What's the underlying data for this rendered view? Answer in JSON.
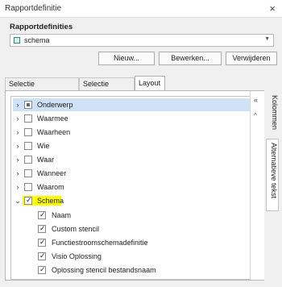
{
  "window": {
    "title": "Rapportdefinitie",
    "close_icon": "×"
  },
  "group": {
    "label": "Rapportdefinities",
    "combo_value": "schema",
    "buttons": {
      "new": "Nieuw...",
      "edit": "Bewerken...",
      "delete": "Verwijderen"
    }
  },
  "tabs": [
    "Selectie Onderwerpen",
    "Selectie Relaties",
    "Layout"
  ],
  "side_tabs": [
    "Kolommen",
    "Alternatieve tekst"
  ],
  "tree": [
    {
      "label": "Onderwerp",
      "expander": "›",
      "checkbox": "partial"
    },
    {
      "label": "Waarmee",
      "expander": "›",
      "checkbox": "unchecked"
    },
    {
      "label": "Waarheen",
      "expander": "›",
      "checkbox": "unchecked"
    },
    {
      "label": "Wie",
      "expander": "›",
      "checkbox": "unchecked"
    },
    {
      "label": "Waar",
      "expander": "›",
      "checkbox": "unchecked"
    },
    {
      "label": "Wanneer",
      "expander": "›",
      "checkbox": "unchecked"
    },
    {
      "label": "Waarom",
      "expander": "›",
      "checkbox": "unchecked"
    },
    {
      "label": "Schema",
      "expander": "⌄",
      "checkbox": "checked",
      "highlight": "#ffff00"
    },
    {
      "label": "Naam",
      "checkbox": "checked"
    },
    {
      "label": "Custom stencil",
      "checkbox": "checked"
    },
    {
      "label": "Functiestroomschemadefinitie",
      "checkbox": "checked"
    },
    {
      "label": "Visio Oplossing",
      "checkbox": "checked"
    },
    {
      "label": "Oplossing stencil bestandsnaam",
      "checkbox": "checked"
    }
  ],
  "scroll": {
    "top_icon": "«",
    "up_icon": "^"
  },
  "colors": {
    "selection": "#cfe1f5",
    "highlight": "#ffff00",
    "schema_swatch": "#2e8b7c"
  }
}
